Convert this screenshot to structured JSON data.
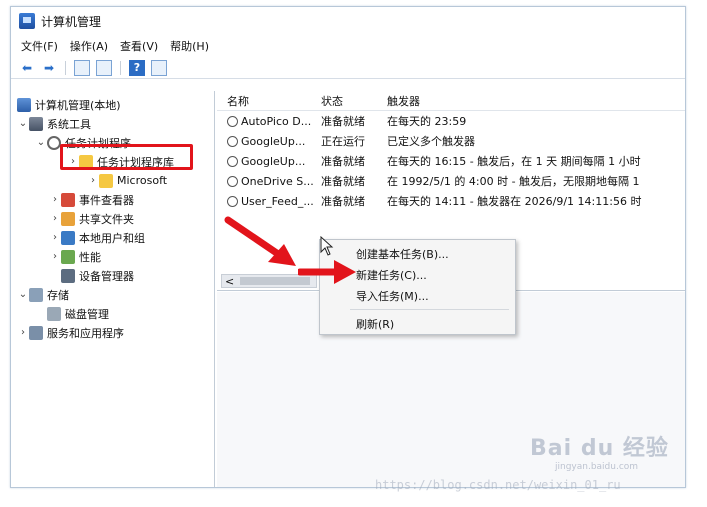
{
  "window": {
    "title": "计算机管理"
  },
  "menubar": {
    "items": [
      "文件(F)",
      "操作(A)",
      "查看(V)",
      "帮助(H)"
    ]
  },
  "toolbar": {
    "help_label": "?"
  },
  "tree": {
    "items": [
      {
        "label": "计算机管理(本地)",
        "icon": "computer-icon"
      },
      {
        "label": "系统工具",
        "icon": "tools-icon"
      },
      {
        "label": "任务计划程序",
        "icon": "clock-icon"
      },
      {
        "label": "任务计划程序库",
        "icon": "clock-folder-icon"
      },
      {
        "label": "Microsoft",
        "icon": "folder-icon"
      },
      {
        "label": "事件查看器",
        "icon": "event-viewer-icon"
      },
      {
        "label": "共享文件夹",
        "icon": "shared-folder-icon"
      },
      {
        "label": "本地用户和组",
        "icon": "users-icon"
      },
      {
        "label": "性能",
        "icon": "performance-icon"
      },
      {
        "label": "设备管理器",
        "icon": "device-manager-icon"
      },
      {
        "label": "存储",
        "icon": "storage-icon"
      },
      {
        "label": "磁盘管理",
        "icon": "disk-icon"
      },
      {
        "label": "服务和应用程序",
        "icon": "services-icon"
      }
    ]
  },
  "list": {
    "columns": {
      "name": "名称",
      "status": "状态",
      "trigger": "触发器"
    },
    "rows": [
      {
        "name": "AutoPico D...",
        "status": "准备就绪",
        "trigger": "在每天的 23:59"
      },
      {
        "name": "GoogleUp...",
        "status": "正在运行",
        "trigger": "已定义多个触发器"
      },
      {
        "name": "GoogleUp...",
        "status": "准备就绪",
        "trigger": "在每天的 16:15 - 触发后，在 1 天 期间每隔 1 小时"
      },
      {
        "name": "OneDrive S...",
        "status": "准备就绪",
        "trigger": "在 1992/5/1 的 4:00 时 - 触发后，无限期地每隔 1"
      },
      {
        "name": "User_Feed_...",
        "status": "准备就绪",
        "trigger": "在每天的 14:11 - 触发器在 2026/9/1 14:11:56 时"
      }
    ],
    "scroll_left": "<"
  },
  "context_menu": {
    "items": [
      "创建基本任务(B)...",
      "新建任务(C)...",
      "导入任务(M)...",
      "刷新(R)"
    ]
  },
  "watermark": {
    "baidu": "Bai du 经验",
    "baidu_sub": "jingyan.baidu.com",
    "url": "https://blog.csdn.net/weixin_01_ru"
  },
  "colors": {
    "highlight": "#e2141b",
    "arrow": "#e2141b"
  }
}
